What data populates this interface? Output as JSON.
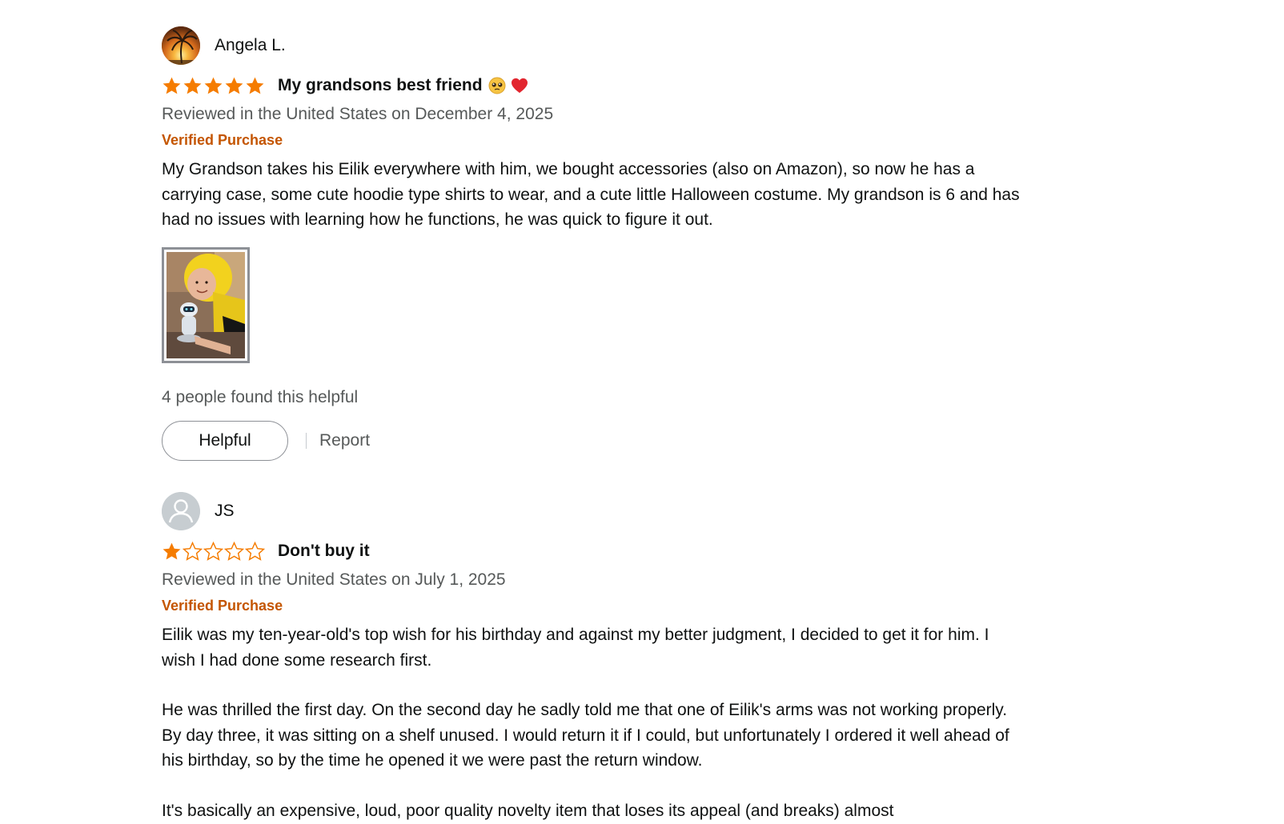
{
  "reviews": [
    {
      "author": "Angela L.",
      "avatar": "sunset-palm-photo",
      "rating": 5,
      "title": "My grandsons best friend",
      "title_emoji": [
        "pleading-face",
        "red-heart"
      ],
      "date": "Reviewed in the United States on December 4, 2025",
      "verified": "Verified Purchase",
      "body": [
        "My Grandson takes his Eilik everywhere with him, we bought accessories (also on Amazon), so now he has a carrying case, some cute hoodie type shirts to wear, and a cute little Halloween costume. My grandson is 6 and has had no issues with learning how he functions, he was quick to figure it out."
      ],
      "images": 1,
      "helpful_count": "4 people found this helpful",
      "helpful_label": "Helpful",
      "report_label": "Report"
    },
    {
      "author": "JS",
      "avatar": "default-user-icon",
      "rating": 1,
      "title": "Don't buy it",
      "date": "Reviewed in the United States on July 1, 2025",
      "verified": "Verified Purchase",
      "body": [
        "Eilik was my ten-year-old's top wish for his birthday and against my better judgment, I decided to get it for him. I wish I had done some research first.",
        "He was thrilled the first day. On the second day he sadly told me that one of Eilik's arms was not working properly. By day three, it was sitting on a shelf unused. I would return it if I could, but unfortunately I ordered it well ahead of his birthday, so by the time he opened it we were past the return window.",
        "It's basically an expensive, loud, poor quality novelty item that loses its appeal (and breaks) almost"
      ]
    }
  ],
  "colors": {
    "star": "#f57c00",
    "verified": "#c45500",
    "muted_text": "#565959",
    "primary_text": "#0f1111",
    "button_border": "#8d9096"
  }
}
